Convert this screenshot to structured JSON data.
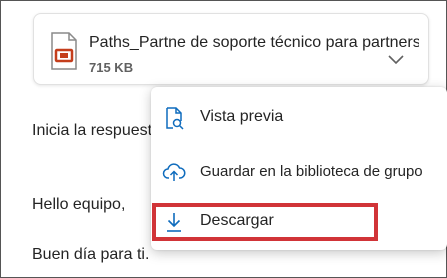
{
  "attachment": {
    "file_name": "Paths_Partne de soporte técnico para partners...",
    "file_size": "715 KB",
    "icon": "powerpoint-file-icon"
  },
  "message": {
    "reply_prompt": "Inicia la respuesta:",
    "greeting": "Hello equipo,",
    "closing": "Buen día para ti."
  },
  "context_menu": {
    "items": [
      {
        "label": "Vista previa",
        "icon": "preview-document-icon"
      },
      {
        "label": "Guardar en la biblioteca de grupo",
        "icon": "cloud-upload-icon"
      },
      {
        "label": "Descargar",
        "icon": "download-icon"
      }
    ]
  },
  "colors": {
    "highlight": "#d13438",
    "accent": "#0f6cbd",
    "file_icon": "#c43e1c"
  }
}
